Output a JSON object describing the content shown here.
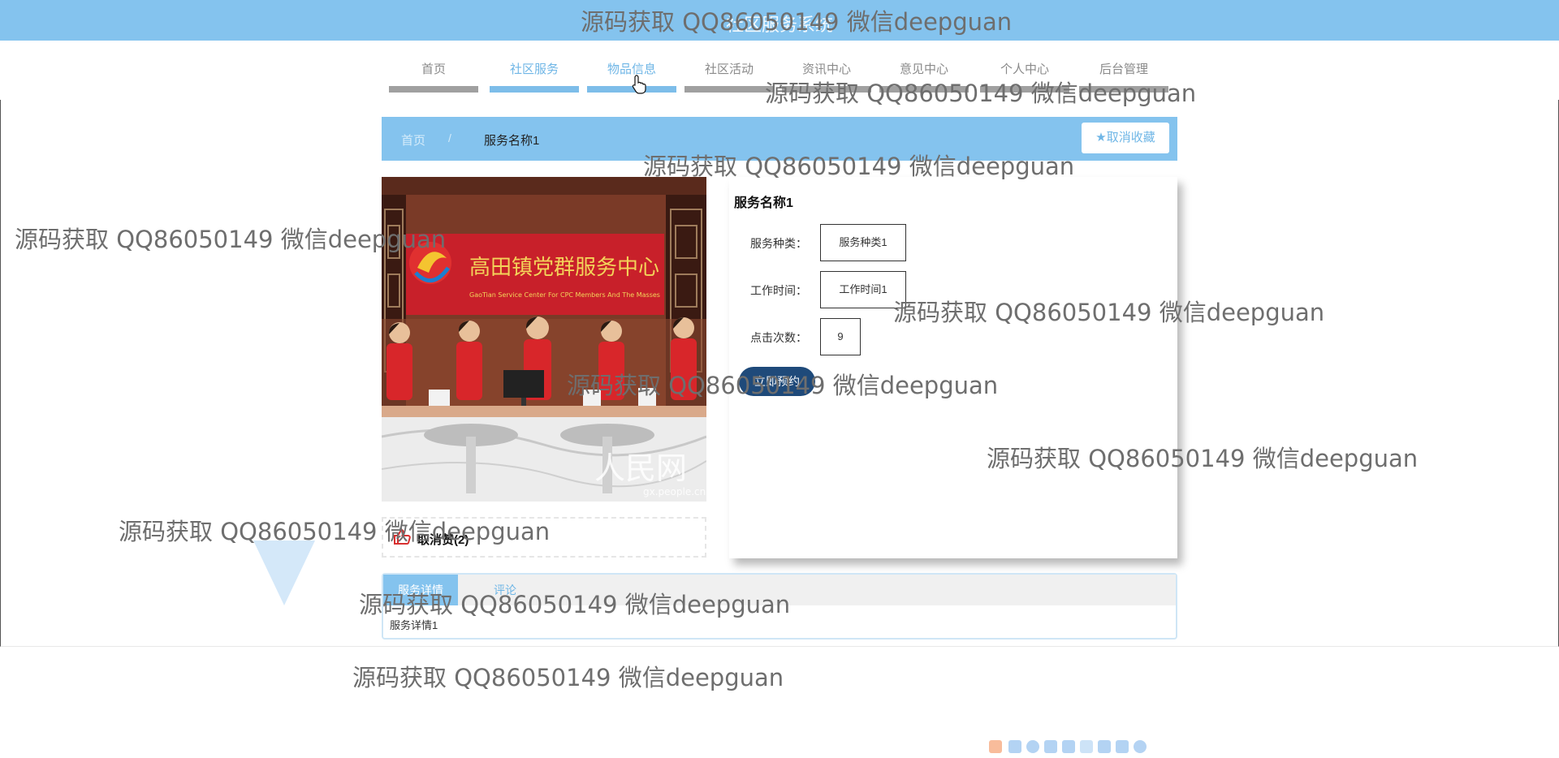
{
  "header": {
    "title": "社区服务系统"
  },
  "nav": {
    "items": [
      {
        "label": "首页"
      },
      {
        "label": "社区服务"
      },
      {
        "label": "物品信息"
      },
      {
        "label": "社区活动"
      },
      {
        "label": "资讯中心"
      },
      {
        "label": "意见中心"
      },
      {
        "label": "个人中心"
      },
      {
        "label": "后台管理"
      }
    ],
    "active_index": 1,
    "hover_index": 2
  },
  "breadcrumb": {
    "home": "首页",
    "separator": "/",
    "current": "服务名称1"
  },
  "favorite": {
    "label": "取消收藏",
    "icon": "star-icon"
  },
  "detail": {
    "title": "服务名称1",
    "fields": [
      {
        "label": "服务种类：",
        "value": "服务种类1"
      },
      {
        "label": "工作时间：",
        "value": "工作时间1"
      },
      {
        "label": "点击次数：",
        "value": "9"
      }
    ],
    "reserve_label": "立即预约"
  },
  "like": {
    "label": "取消赞(2)",
    "icon": "thumb-up-icon"
  },
  "tabs": {
    "items": [
      {
        "label": "服务详情"
      },
      {
        "label": "评论"
      }
    ],
    "active_index": 0,
    "content": "服务详情1"
  },
  "photo": {
    "sign_cn": "高田镇党群服务中心",
    "sign_en": "GaoTian Service Center For CPC Members And The Masses",
    "watermark": "人民网",
    "watermark_url": "gx.people.cn"
  },
  "watermark_text": "源码获取 QQ86050149 微信deepguan",
  "colors": {
    "primary": "#84c3ee",
    "accent": "#6fb6e6",
    "button_dark": "#1f4a7a"
  }
}
